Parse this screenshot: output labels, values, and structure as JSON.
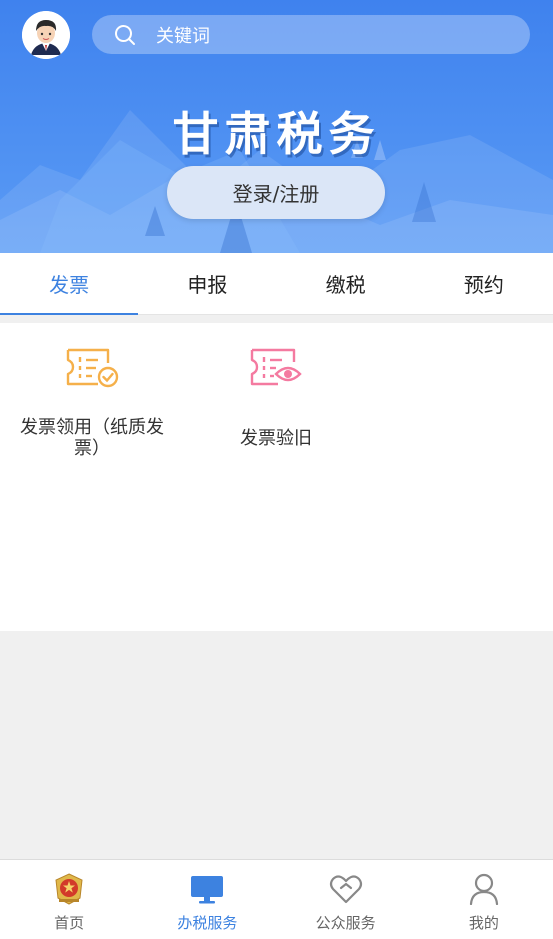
{
  "header": {
    "title": "甘肃税务",
    "avatar_icon": "user-avatar-icon",
    "search": {
      "placeholder": "关键词",
      "icon": "search-icon"
    },
    "login_button": "登录/注册",
    "background_color": "#4a8cf0"
  },
  "tabs": [
    {
      "label": "发票",
      "active": true
    },
    {
      "label": "申报",
      "active": false
    },
    {
      "label": "缴税",
      "active": false
    },
    {
      "label": "预约",
      "active": false
    }
  ],
  "services": [
    {
      "label": "发票领用（纸质发票）",
      "icon": "invoice-check-icon",
      "color": "#f5b04a"
    },
    {
      "label": "发票验旧",
      "icon": "invoice-view-icon",
      "color": "#f47aa0"
    }
  ],
  "bottom_nav": [
    {
      "label": "首页",
      "icon": "emblem-icon",
      "active": false
    },
    {
      "label": "办税服务",
      "icon": "monitor-icon",
      "active": true
    },
    {
      "label": "公众服务",
      "icon": "heart-icon",
      "active": false
    },
    {
      "label": "我的",
      "icon": "person-icon",
      "active": false
    }
  ],
  "accent_color": "#3d82e0"
}
